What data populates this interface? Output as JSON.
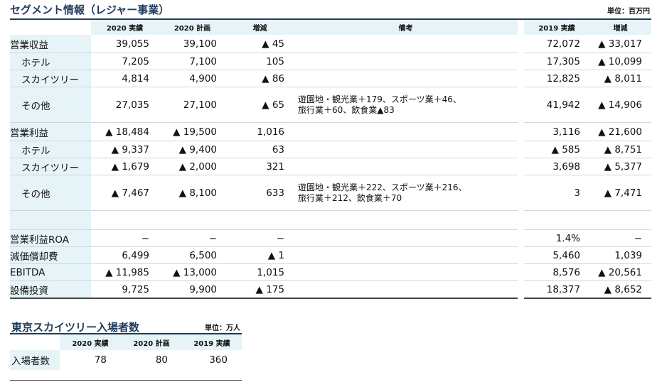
{
  "segment": {
    "title": "セグメント情報（レジャー事業）",
    "unit": "単位：百万円",
    "headers": [
      "",
      "2020 実績",
      "2020 計画",
      "増減",
      "備考",
      "",
      "2019 実績",
      "増減"
    ],
    "rows": [
      {
        "label": "営業収益",
        "sub": false,
        "cls": "r27",
        "values": [
          "39,055",
          "39,100",
          "▲ 45",
          "",
          "72,072",
          "▲ 33,017"
        ]
      },
      {
        "label": "ホテル",
        "sub": true,
        "cls": "r24",
        "values": [
          "7,205",
          "7,100",
          "105",
          "",
          "17,305",
          "▲ 10,099"
        ]
      },
      {
        "label": "スカイツリー",
        "sub": true,
        "cls": "r24",
        "values": [
          "4,814",
          "4,900",
          "▲ 86",
          "",
          "12,825",
          "▲ 8,011"
        ]
      },
      {
        "label": "その他",
        "sub": true,
        "cls": "r50",
        "values": [
          "27,035",
          "27,100",
          "▲ 65",
          "遊園地・観光業＋179、スポーツ業＋46、\n旅行業＋60、飲食業▲83",
          "41,942",
          "▲ 14,906"
        ]
      },
      {
        "label": "営業利益",
        "sub": false,
        "cls": "r27",
        "values": [
          "▲ 18,484",
          "▲ 19,500",
          "1,016",
          "",
          "3,116",
          "▲ 21,600"
        ]
      },
      {
        "label": "ホテル",
        "sub": true,
        "cls": "r24",
        "values": [
          "▲ 9,337",
          "▲ 9,400",
          "63",
          "",
          "▲ 585",
          "▲ 8,751"
        ]
      },
      {
        "label": "スカイツリー",
        "sub": true,
        "cls": "r24",
        "values": [
          "▲ 1,679",
          "▲ 2,000",
          "321",
          "",
          "3,698",
          "▲ 5,377"
        ]
      },
      {
        "label": "その他",
        "sub": true,
        "cls": "r50",
        "values": [
          "▲ 7,467",
          "▲ 8,100",
          "633",
          "遊園地・観光業＋222、スポーツ業＋216、\n旅行業＋212、飲食業＋70",
          "3",
          "▲ 7,471"
        ]
      },
      {
        "label": "",
        "sub": false,
        "cls": "empty",
        "values": [
          "",
          "",
          "",
          "",
          "",
          ""
        ]
      },
      {
        "label": "営業利益ROA",
        "sub": false,
        "cls": "r24",
        "values": [
          "−",
          "−",
          "−",
          "",
          "1.4%",
          "−"
        ]
      },
      {
        "label": "減価償却費",
        "sub": false,
        "cls": "r24",
        "values": [
          "6,499",
          "6,500",
          "▲ 1",
          "",
          "5,460",
          "1,039"
        ]
      },
      {
        "label": "EBITDA",
        "sub": false,
        "cls": "r24",
        "values": [
          "▲ 11,985",
          "▲ 13,000",
          "1,015",
          "",
          "8,576",
          "▲ 20,561"
        ]
      },
      {
        "label": "設備投資",
        "sub": false,
        "cls": "r24 last",
        "values": [
          "9,725",
          "9,900",
          "▲ 175",
          "",
          "18,377",
          "▲ 8,652"
        ]
      }
    ]
  },
  "visitors": {
    "title": "東京スカイツリー入場者数",
    "unit": "単位：万人",
    "headers": [
      "",
      "2020 実績",
      "2020 計画",
      "2019 実績"
    ],
    "row": {
      "label": "入場者数",
      "values": [
        "78",
        "80",
        "360"
      ]
    }
  }
}
